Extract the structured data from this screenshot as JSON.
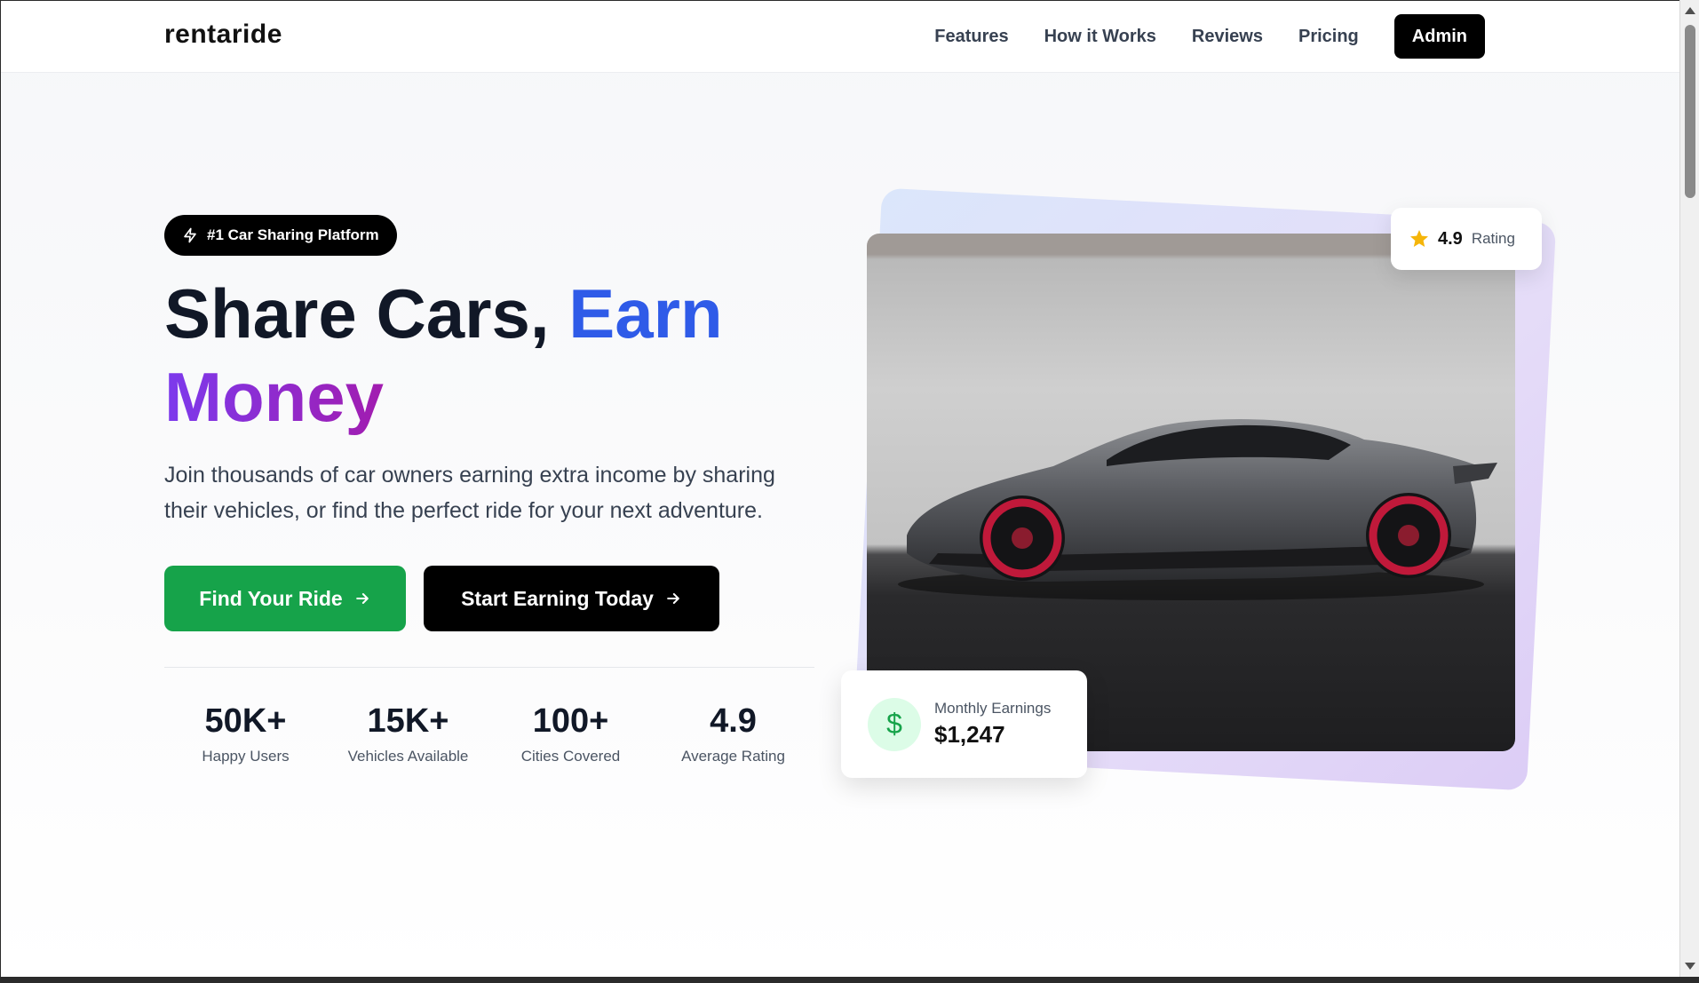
{
  "brand": {
    "logo": "rentaride"
  },
  "nav": {
    "links": [
      "Features",
      "How it Works",
      "Reviews",
      "Pricing"
    ],
    "admin_label": "Admin"
  },
  "hero": {
    "badge": "#1 Car Sharing Platform",
    "headline": {
      "part1": "Share Cars, ",
      "part2": "Earn",
      "part3": "Money"
    },
    "subtitle": "Join thousands of car owners earning extra income by sharing their vehicles, or find the perfect ride for your next adventure.",
    "primary_cta": "Find Your Ride",
    "secondary_cta": "Start Earning Today",
    "stats": [
      {
        "value": "50K+",
        "label": "Happy Users"
      },
      {
        "value": "15K+",
        "label": "Vehicles Available"
      },
      {
        "value": "100+",
        "label": "Cities Covered"
      },
      {
        "value": "4.9",
        "label": "Average Rating"
      }
    ]
  },
  "showcase": {
    "rating": {
      "value": "4.9",
      "label": "Rating"
    },
    "earnings": {
      "label": "Monthly Earnings",
      "value": "$1,247",
      "icon": "$"
    }
  },
  "colors": {
    "accent_blue": "#2f5be8",
    "accent_purple": "#7c3aed",
    "cta_green": "#16a34a",
    "star": "#f5b50a"
  }
}
